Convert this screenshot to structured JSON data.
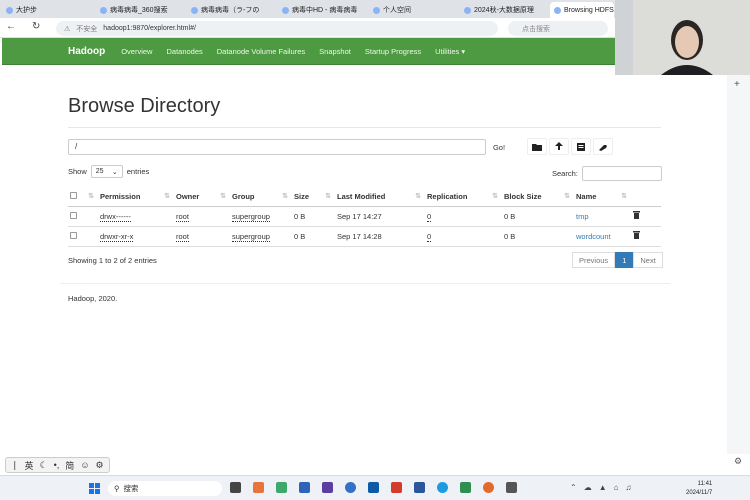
{
  "browser": {
    "tabs": [
      "大护步",
      "病毒病毒_360搜索",
      "病毒病毒（ラ-フの",
      "病毒中HD - 病毒病毒",
      "个人空间",
      "2024秋-大数据原理",
      "Browsing HDFS"
    ],
    "url_warning": "不安全",
    "url": "hadoop1:9870/explorer.html#/",
    "search_placeholder": "点击搜索"
  },
  "navbar": {
    "brand": "Hadoop",
    "items": [
      "Overview",
      "Datanodes",
      "Datanode Volume Failures",
      "Snapshot",
      "Startup Progress",
      "Utilities ▾"
    ]
  },
  "page": {
    "title": "Browse Directory",
    "path": "/",
    "go_label": "Go!",
    "show_label": "Show",
    "page_size": "25",
    "entries_label": "entries",
    "search_label": "Search:"
  },
  "table": {
    "headers": [
      "Permission",
      "Owner",
      "Group",
      "Size",
      "Last Modified",
      "Replication",
      "Block Size",
      "Name"
    ],
    "rows": [
      {
        "permission": "drwx------",
        "owner": "root",
        "group": "supergroup",
        "size": "0 B",
        "modified": "Sep 17 14:27",
        "replication": "0",
        "block_size": "0 B",
        "name": "tmp"
      },
      {
        "permission": "drwxr-xr-x",
        "owner": "root",
        "group": "supergroup",
        "size": "0 B",
        "modified": "Sep 17 14:28",
        "replication": "0",
        "block_size": "0 B",
        "name": "wordcount"
      }
    ]
  },
  "info": "Showing 1 to 2 of 2 entries",
  "pager": {
    "prev": "Previous",
    "current": "1",
    "next": "Next"
  },
  "footer": "Hadoop, 2020.",
  "ime": {
    "lang": "英",
    "mode": "简"
  },
  "taskbar": {
    "search": "搜索",
    "time": "11:41",
    "date": "2024/11/7"
  },
  "colors": {
    "navbar": "#4e9a43",
    "link": "#337ab7"
  }
}
